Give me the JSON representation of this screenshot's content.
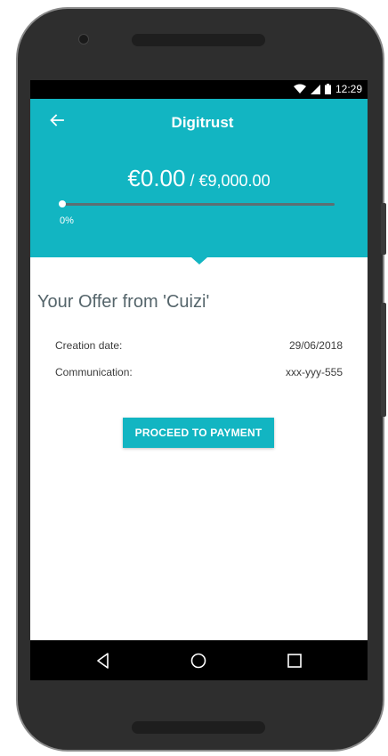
{
  "status_bar": {
    "time": "12:29",
    "icons": [
      "wifi-icon",
      "signal-icon",
      "battery-icon"
    ]
  },
  "header": {
    "title": "Digitrust",
    "back_icon": "arrow-left-icon",
    "amount_current": "€0.00",
    "amount_separator": " / ",
    "amount_total": "€9,000.00",
    "progress_percent_label": "0%",
    "progress_fraction": 0
  },
  "offer": {
    "title": "Your Offer from 'Cuizi'",
    "rows": [
      {
        "label": "Creation date:",
        "value": "29/06/2018"
      },
      {
        "label": "Communication:",
        "value": "xxx-yyy-555"
      }
    ],
    "pay_button_label": "PROCEED TO PAYMENT"
  },
  "nav_bar": {
    "icons": [
      "nav-back-icon",
      "nav-home-icon",
      "nav-recent-apps-icon"
    ]
  },
  "colors": {
    "accent": "#12b5c2",
    "title_text": "#55656b",
    "status_bar": "#000000"
  }
}
